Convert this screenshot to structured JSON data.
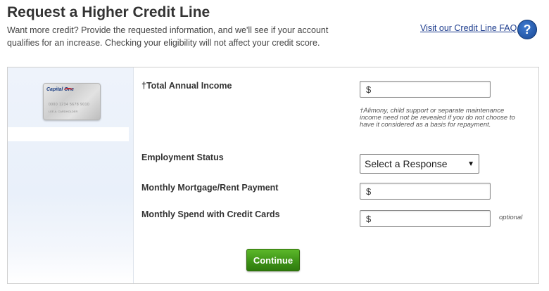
{
  "header": {
    "title": "Request a Higher Credit Line",
    "intro": "Want more credit? Provide the requested information, and we'll see if your account qualifies for an increase. Checking your eligibility will not affect your credit score.",
    "faq_link": "Visit our Credit Line FAQ",
    "help_symbol": "?"
  },
  "card_image": {
    "brand": "Capital One",
    "number": "0000 1234 5678 9010",
    "cardholder": "LEE A. CARDHOLDER"
  },
  "form": {
    "income": {
      "label": "†Total Annual Income",
      "value": "$",
      "note": "†Alimony, child support or separate maintenance income need not be revealed if you do not choose to have it considered as a basis for repayment."
    },
    "employment": {
      "label": "Employment Status",
      "selected": "Select a Response"
    },
    "mortgage": {
      "label": "Monthly Mortgage/Rent Payment",
      "value": "$"
    },
    "spend": {
      "label": "Monthly Spend with Credit Cards",
      "value": "$",
      "optional": "optional"
    },
    "continue_label": "Continue"
  },
  "colors": {
    "link": "#1a3a8c",
    "button_green": "#3f9418",
    "help_blue": "#1a4a96"
  }
}
